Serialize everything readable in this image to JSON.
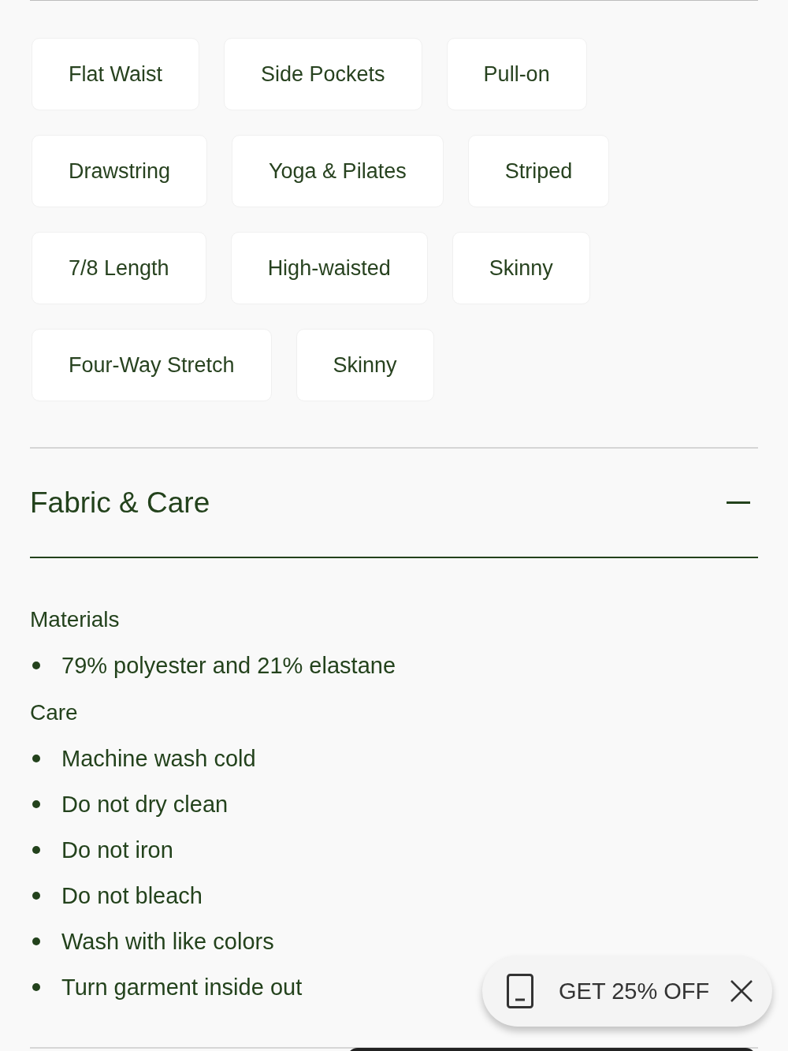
{
  "tag_rows": [
    [
      "Flat Waist",
      "Side Pockets",
      "Pull-on"
    ],
    [
      "Drawstring",
      "Yoga & Pilates",
      "Striped"
    ],
    [
      "7/8 Length",
      "High-waisted",
      "Skinny"
    ],
    [
      "Four-Way Stretch",
      "Skinny"
    ]
  ],
  "section": {
    "title": "Fabric & Care",
    "expanded": true,
    "groups": [
      {
        "heading": "Materials",
        "items": [
          "79% polyester and 21% elastane"
        ]
      },
      {
        "heading": "Care",
        "items": [
          "Machine wash cold",
          "Do not dry clean",
          "Do not iron",
          "Do not bleach",
          "Wash with like colors",
          "Turn garment inside out"
        ]
      }
    ]
  },
  "promo": {
    "text": "GET 25% OFF"
  }
}
